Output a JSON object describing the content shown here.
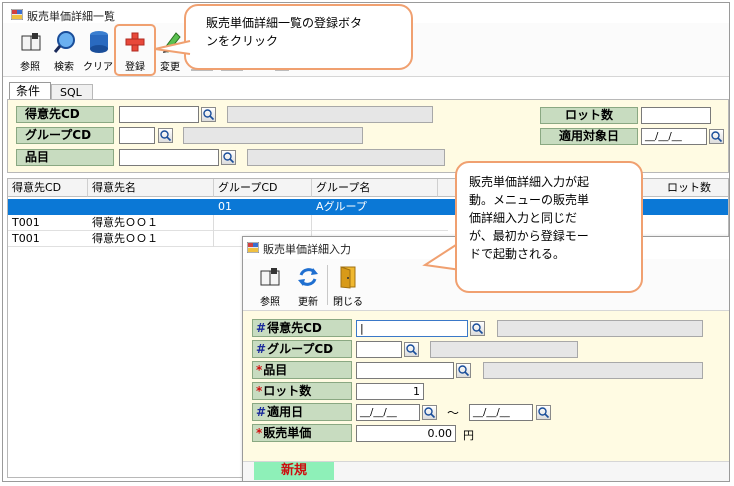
{
  "window": {
    "title": "販売単価詳細一覧"
  },
  "toolbar": {
    "reference": "参照",
    "search": "検索",
    "clear": "クリア",
    "register": "登録",
    "change": "変更"
  },
  "tabs": [
    {
      "label": "条件"
    },
    {
      "label": "SQL"
    }
  ],
  "filters": {
    "customer_cd": "得意先CD",
    "group_cd": "グループCD",
    "item": "品目",
    "lot_qty": "ロット数",
    "apply_target_date": "適用対象日",
    "date_value": "__/__/__"
  },
  "grid": {
    "columns": [
      "得意先CD",
      "得意先名",
      "グループCD",
      "グループ名",
      "ロット数"
    ],
    "rows": [
      [
        "",
        "",
        "01",
        "Aグループ"
      ],
      [
        "T001",
        "得意先ＯＯ１",
        "",
        ""
      ],
      [
        "T001",
        "得意先ＯＯ１",
        "",
        ""
      ]
    ]
  },
  "callouts": {
    "top": [
      "販売単価詳細一覧の登録ボタ",
      "ンをクリック"
    ],
    "right": [
      "販売単価詳細入力が起",
      "動。メニューの販売単",
      "価詳細入力と同じだ",
      "が、最初から登録モー",
      "ドで起動される。"
    ]
  },
  "dialog": {
    "title": "販売単価詳細入力",
    "toolbar": {
      "reference": "参照",
      "update": "更新",
      "close": "閉じる"
    },
    "fields": {
      "customer_cd": "得意先CD",
      "group_cd": "グループCD",
      "item": "品目",
      "lot_qty": "ロット数",
      "apply_date": "適用日",
      "unit_price": "販売単価"
    },
    "values": {
      "customer_cd": "|",
      "lot_qty": "1",
      "date_from": "__/__/__",
      "tilde": "～",
      "date_to": "__/__/__",
      "unit_price": "0.00",
      "yen": "円"
    },
    "mode": "新規"
  },
  "colors": {
    "selection": "#0b78d6",
    "label_bg": "#c8dcc0",
    "callout_border": "#f0a070",
    "mode_bg": "#8ef0b8",
    "mode_text": "#cc1010"
  }
}
